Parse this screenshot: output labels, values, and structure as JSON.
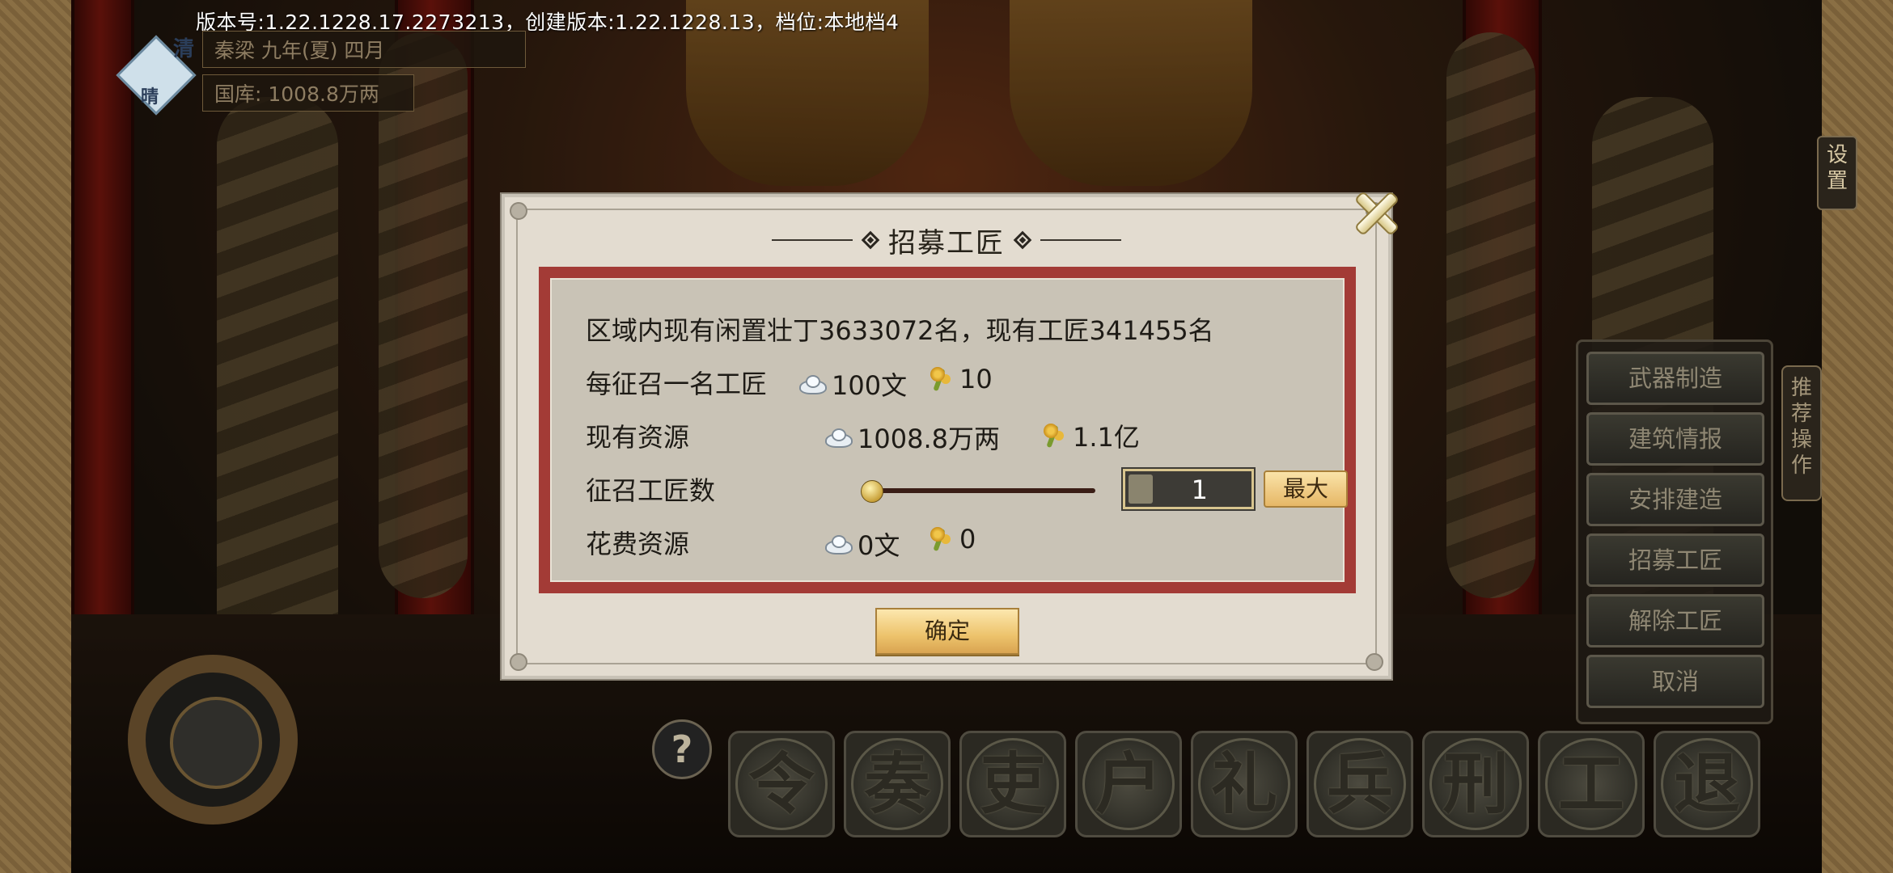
{
  "hud": {
    "version_text": "版本号:1.22.1228.17.2273213，创建版本:1.22.1228.13，档位:本地档4",
    "weather_char_1": "清",
    "weather_char_2": "晴",
    "date": "秦梁 九年(夏) 四月",
    "treasury": "国库: 1008.8万两",
    "settings_label": "设置",
    "recommend_label": "推荐操作"
  },
  "side_menu": {
    "items": [
      {
        "label": "武器制造"
      },
      {
        "label": "建筑情报"
      },
      {
        "label": "安排建造"
      },
      {
        "label": "招募工匠"
      },
      {
        "label": "解除工匠"
      },
      {
        "label": "取消"
      }
    ]
  },
  "bottom_bar": {
    "help_label": "?",
    "actions": [
      {
        "label": "令"
      },
      {
        "label": "奏"
      },
      {
        "label": "吏"
      },
      {
        "label": "户"
      },
      {
        "label": "礼"
      },
      {
        "label": "兵"
      },
      {
        "label": "刑"
      },
      {
        "label": "工"
      },
      {
        "label": "退"
      }
    ]
  },
  "dialog": {
    "title": "招募工匠",
    "summary": "区域内现有闲置壮丁3633072名，现有工匠341455名",
    "cost_per_label": "每征召一名工匠",
    "cost_per_silver": "100文",
    "cost_per_grain": "10",
    "current_label": "现有资源",
    "current_silver": "1008.8万两",
    "current_grain": "1.1亿",
    "count_label": "征召工匠数",
    "count_value": "1",
    "max_label": "最大",
    "spend_label": "花费资源",
    "spend_silver": "0文",
    "spend_grain": "0",
    "confirm_label": "确定",
    "slider_fraction": 0
  }
}
